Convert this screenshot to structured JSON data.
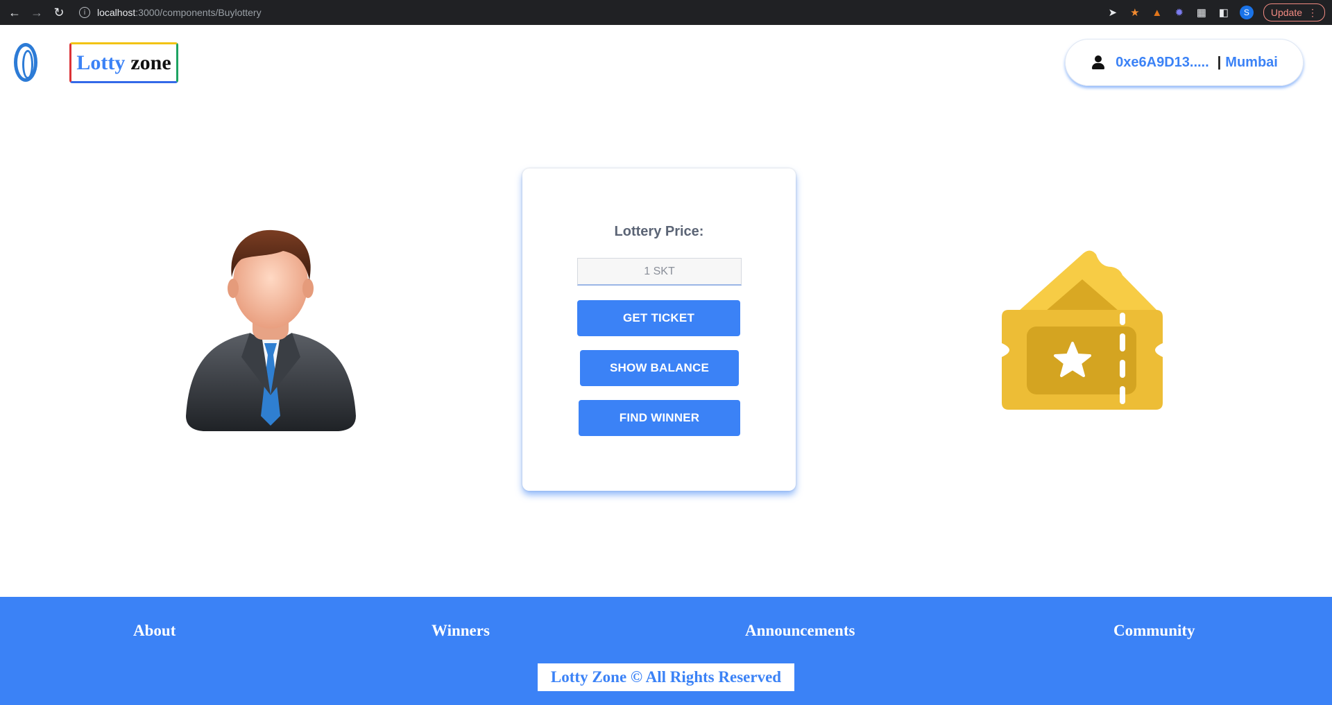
{
  "browser": {
    "url_host": "localhost",
    "url_rest": ":3000/components/Buylottery",
    "profile_initial": "S",
    "update_label": "Update"
  },
  "header": {
    "brand_part1": "Lotty",
    "brand_part2": "zone",
    "account_address": "0xe6A9D13.....",
    "account_separator": "|",
    "account_network": "Mumbai"
  },
  "card": {
    "title": "Lottery Price:",
    "price_value": "1 SKT",
    "get_ticket_label": "GET TICKET",
    "show_balance_label": "SHOW BALANCE",
    "find_winner_label": "FIND WINNER"
  },
  "footer": {
    "links": [
      "About",
      "Winners",
      "Announcements",
      "Community"
    ],
    "copyright": "Lotty Zone © All Rights Reserved"
  },
  "colors": {
    "accent": "#3b82f6",
    "ticket": "#f0c13a"
  }
}
